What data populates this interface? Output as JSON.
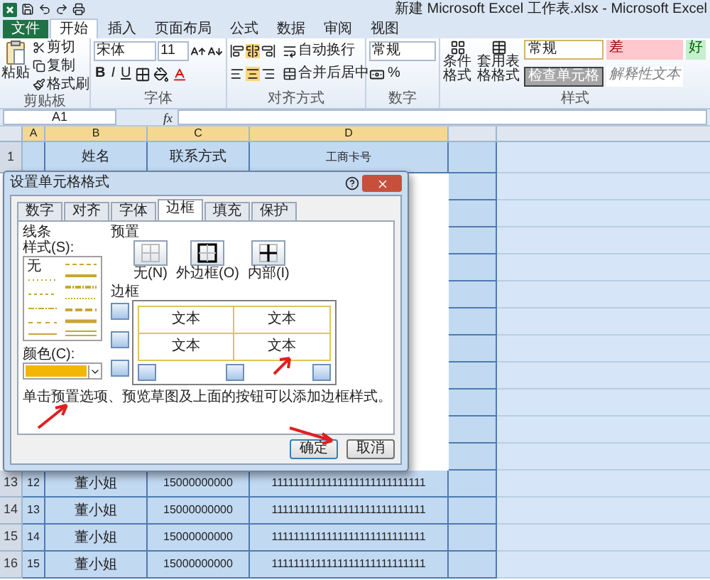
{
  "window": {
    "title": "新建 Microsoft Excel 工作表.xlsx - Microsoft Excel"
  },
  "ribbon_tabs": [
    {
      "label": "文件",
      "kind": "file",
      "selected": false
    },
    {
      "label": "开始",
      "kind": "tab",
      "selected": true
    },
    {
      "label": "插入",
      "kind": "tab",
      "selected": false
    },
    {
      "label": "页面布局",
      "kind": "tab",
      "selected": false
    },
    {
      "label": "公式",
      "kind": "tab",
      "selected": false
    },
    {
      "label": "数据",
      "kind": "tab",
      "selected": false
    },
    {
      "label": "审阅",
      "kind": "tab",
      "selected": false
    },
    {
      "label": "视图",
      "kind": "tab",
      "selected": false
    }
  ],
  "clipboard": {
    "paste": "粘贴",
    "cut": "剪切",
    "copy": "复制",
    "format_painter": "格式刷",
    "label": "剪贴板"
  },
  "font": {
    "font_name": "宋体",
    "font_size": "11",
    "bold": "B",
    "italic": "I",
    "underline": "U",
    "label": "字体"
  },
  "alignment": {
    "wrap": "自动换行",
    "merge": "合并后居中",
    "label": "对齐方式"
  },
  "number": {
    "format": "常规",
    "percent": "%",
    "label": "数字"
  },
  "styles": {
    "conditional": "条件格式",
    "table_format": "套用表格格式",
    "label": "样式",
    "cells": [
      {
        "text": "常规",
        "kind": "normal"
      },
      {
        "text": "检查单元格",
        "kind": "check"
      },
      {
        "text": "差",
        "kind": "bad"
      },
      {
        "text": "解释性文本",
        "kind": "explanatory"
      },
      {
        "text": "好",
        "kind": "good"
      }
    ]
  },
  "formula_bar": {
    "name_box": "A1",
    "function_label": "fx"
  },
  "sheet": {
    "columns": [
      "A",
      "B",
      "C",
      "D"
    ],
    "header_row": {
      "number": "1",
      "cells": [
        "",
        "姓名",
        "联系方式",
        "工商卡号"
      ]
    },
    "rows": [
      {
        "number": "13",
        "cells": [
          "12",
          "董小姐",
          "15000000000",
          "1111111111111111111111111111"
        ]
      },
      {
        "number": "14",
        "cells": [
          "13",
          "董小姐",
          "15000000000",
          "1111111111111111111111111111"
        ]
      },
      {
        "number": "15",
        "cells": [
          "14",
          "董小姐",
          "15000000000",
          "1111111111111111111111111111"
        ]
      },
      {
        "number": "16",
        "cells": [
          "15",
          "董小姐",
          "15000000000",
          "1111111111111111111111111111"
        ]
      }
    ]
  },
  "dialog": {
    "title": "设置单元格格式",
    "tabs": [
      {
        "label": "数字",
        "selected": false
      },
      {
        "label": "对齐",
        "selected": false
      },
      {
        "label": "字体",
        "selected": false
      },
      {
        "label": "边框",
        "selected": true
      },
      {
        "label": "填充",
        "selected": false
      },
      {
        "label": "保护",
        "selected": false
      }
    ],
    "line_label": "线条",
    "style_label": "样式(S):",
    "style_none": "无",
    "color_label": "颜色(C):",
    "preset_label": "预置",
    "presets": [
      {
        "label": "无(N)",
        "kind": "none"
      },
      {
        "label": "外边框(O)",
        "kind": "outline"
      },
      {
        "label": "内部(I)",
        "kind": "inside"
      }
    ],
    "border_label": "边框",
    "preview_texts": [
      "文本",
      "文本",
      "文本",
      "文本"
    ],
    "hint": "单击预置选项、预览草图及上面的按钮可以添加边框样式。",
    "buttons": [
      {
        "label": "确定",
        "kind": "primary"
      },
      {
        "label": "取消",
        "kind": "secondary"
      }
    ]
  }
}
